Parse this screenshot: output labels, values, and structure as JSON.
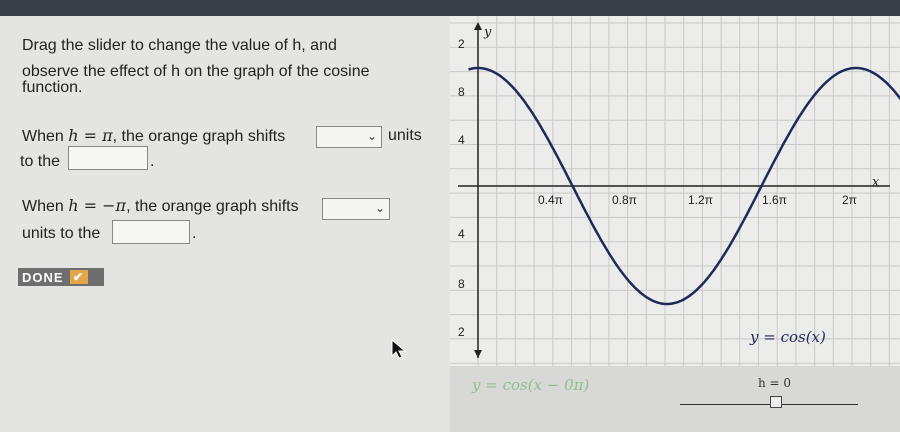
{
  "instructions": {
    "line1": "Drag the slider to change the value of h, and",
    "line2": "observe the effect of h on the graph of the cosine",
    "line3": "function."
  },
  "question1": {
    "prefix": "When ",
    "math": "h = π",
    "middle": ", the orange graph shifts",
    "units": "units",
    "to_the": "to the",
    "period": "."
  },
  "question2": {
    "prefix": "When ",
    "math": "h = −π",
    "middle": ", the orange graph shifts",
    "units_to_the": "units to the",
    "period": "."
  },
  "done": {
    "label": "DONE",
    "check": "✔"
  },
  "graph": {
    "y_axis_label": "y",
    "x_axis_label": "x",
    "y_tick_labels": [
      "2",
      "8",
      "4",
      "4",
      "8",
      "2"
    ],
    "x_tick_labels": [
      "0.4π",
      "0.8π",
      "1.2π",
      "1.6π",
      "2π"
    ],
    "curve_label": "y = cos(x)"
  },
  "bottom": {
    "equation": "y = cos(x − 0π)",
    "slider_label": "h = 0",
    "slider_value": 0
  },
  "colors": {
    "curve": "#1e2a5a",
    "grid": "#c9c9c7",
    "check": "#e3a64a"
  }
}
